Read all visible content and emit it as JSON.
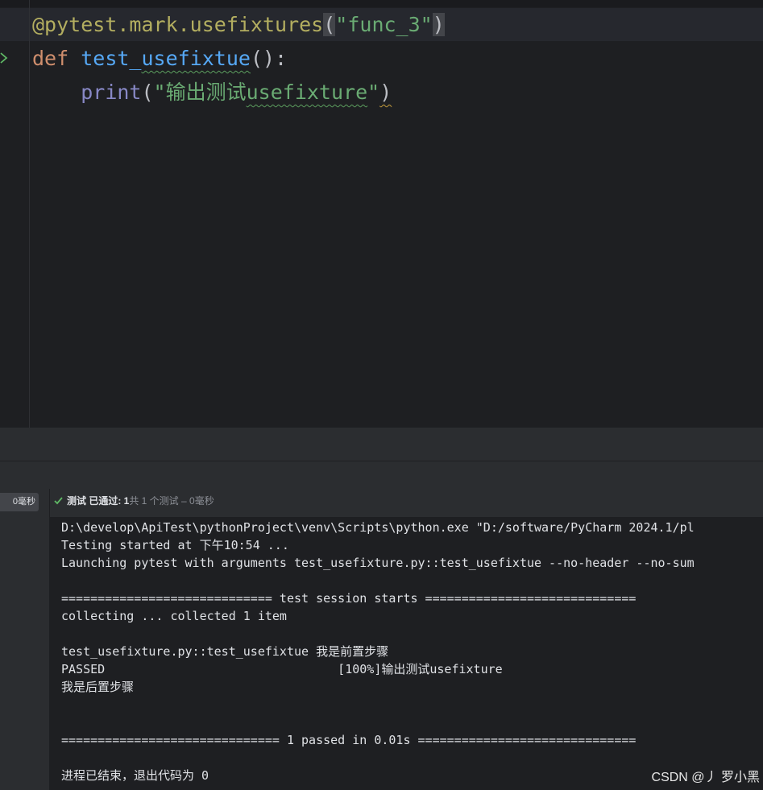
{
  "editor": {
    "line1": {
      "decorator": "@pytest.mark.usefixtures",
      "open_paren": "(",
      "arg": "\"func_3\"",
      "close_paren": ")"
    },
    "line2": {
      "keyword": "def",
      "space": " ",
      "func_name": "test_",
      "func_name_squiggle": "usefixtue",
      "tail": "():"
    },
    "line3": {
      "indent": "    ",
      "builtin": "print",
      "open_paren": "(",
      "string_a": "\"输出测试",
      "string_squiggle": "usefixture",
      "string_b": "\"",
      "close_paren": ")"
    },
    "run_icon": "run-arrow-icon"
  },
  "test_panel": {
    "duration_badge": "0毫秒",
    "status_icon": "check-icon",
    "result": {
      "label": "测试 已通过: 1",
      "summary": "共 1 个测试 – 0毫秒"
    },
    "console_lines": [
      "D:\\develop\\ApiTest\\pythonProject\\venv\\Scripts\\python.exe \"D:/software/PyCharm 2024.1/pl",
      "Testing started at 下午10:54 ...",
      "Launching pytest with arguments test_usefixture.py::test_usefixtue --no-header --no-sum",
      "",
      "============================= test session starts =============================",
      "collecting ... collected 1 item",
      "",
      "test_usefixture.py::test_usefixtue 我是前置步骤",
      "PASSED                                [100%]输出测试usefixture",
      "我是后置步骤",
      "",
      "",
      "============================== 1 passed in 0.01s ==============================",
      "",
      "进程已结束，退出代码为 0"
    ]
  },
  "watermark": "CSDN @丿 罗小黑",
  "colors": {
    "editor_bg": "#1e1f22",
    "panel_bg": "#2b2d30",
    "decorator": "#b3ae60",
    "keyword": "#cf8e6d",
    "function": "#56a8f5",
    "builtin": "#8888c6",
    "string": "#6aab73",
    "success": "#5fb865"
  }
}
